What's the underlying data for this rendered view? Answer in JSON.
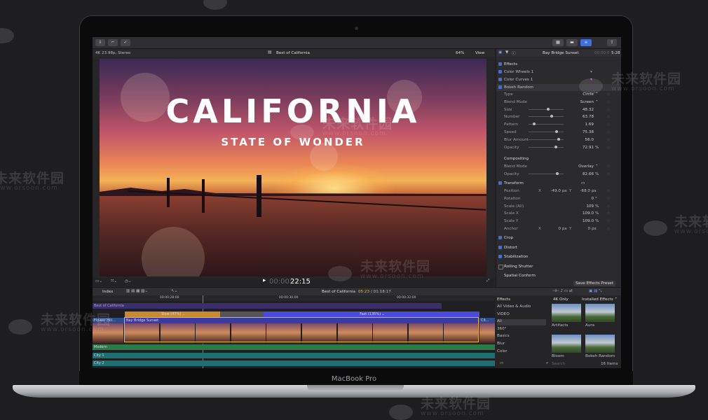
{
  "watermark": {
    "text": "未来软件园",
    "url": "www.orsoon.com"
  },
  "laptop": {
    "brand_label": "MacBook Pro"
  },
  "toolbar": {
    "icons": [
      "import-icon",
      "keyword-icon",
      "check-icon",
      "library-icon",
      "timeline-icon",
      "inspector-icon",
      "share-icon"
    ]
  },
  "viewer": {
    "format": "4K 23.98p, Stereo",
    "project": "Best of California",
    "zoom": "64%",
    "view_label": "View",
    "title_line1": "CALIFORNIA",
    "title_line2": "STATE OF WONDER",
    "timecode_dim": "00:00:",
    "timecode": "22:15"
  },
  "inspector": {
    "clip_name": "Bay Bridge Sunset",
    "clip_time_dim": "00:00:0",
    "clip_time": "5:28",
    "effects_header": "Effects",
    "effects": [
      "Color Wheels 1",
      "Color Curves 1",
      "Bokeh Random"
    ],
    "bokeh_params": [
      {
        "label": "Type",
        "value": "Circle",
        "unit": "⌃"
      },
      {
        "label": "Blend Mode",
        "value": "Screen",
        "unit": "⌃"
      },
      {
        "label": "Size",
        "value": "48.32",
        "unit": "",
        "level": 0.55
      },
      {
        "label": "Number",
        "value": "63.78",
        "unit": "",
        "level": 0.65
      },
      {
        "label": "Pattern",
        "value": "1.69",
        "unit": "",
        "level": 0.12
      },
      {
        "label": "Speed",
        "value": "75.38",
        "unit": "",
        "level": 0.8
      },
      {
        "label": "Blur Amount",
        "value": "56.0",
        "unit": "",
        "level": 0.85
      },
      {
        "label": "Opacity",
        "value": "72.91",
        "unit": "%",
        "level": 0.78
      }
    ],
    "compositing_header": "Compositing",
    "compositing": [
      {
        "label": "Blend Mode",
        "value": "Overlay",
        "unit": "⌃"
      },
      {
        "label": "Opacity",
        "value": "82.66",
        "unit": "%",
        "level": 0.82
      }
    ],
    "transform_header": "Transform",
    "transform": [
      {
        "label": "Position",
        "x": "-49.0",
        "y": "-68.0",
        "unit": "px"
      },
      {
        "label": "Rotation",
        "value": "0",
        "unit": "°"
      },
      {
        "label": "Scale (All)",
        "value": "109",
        "unit": "%"
      },
      {
        "label": "Scale X",
        "value": "109.0",
        "unit": "%"
      },
      {
        "label": "Scale Y",
        "value": "109.0",
        "unit": "%"
      },
      {
        "label": "Anchor",
        "x": "0",
        "y": "0",
        "unit": "px"
      }
    ],
    "sections": [
      "Crop",
      "Distort",
      "Stabilization",
      "Rolling Shutter",
      "Spatial Conform"
    ],
    "save_preset": "Save Effects Preset"
  },
  "timeline": {
    "index_label": "Index",
    "project": "Best of California",
    "position": "05:23",
    "duration": "/ 01:18:17",
    "ruler": [
      "00:00:28:00",
      "00:00:30:00",
      "00:00:32:00"
    ],
    "top_track": "Best of California",
    "speed_slow": "Slow (47%) ⌄",
    "speed_fast": "Fast (135%) ⌄",
    "clip_left": "Flower Hill...",
    "clip_main": "Bay Bridge Sunset",
    "clip_right": "Cit...",
    "audio_tracks": [
      "Modern",
      "City 1",
      "City 2"
    ]
  },
  "browser": {
    "effects_label": "Effects",
    "filter_4k": "4K Only",
    "installed": "Installed Effects ⌃",
    "categories": [
      "All Video & Audio",
      "VIDEO",
      "All",
      "360°",
      "Basics",
      "Blur",
      "Color"
    ],
    "thumbs": [
      "Artifacts",
      "Aura",
      "Bloom",
      "Bokeh Random"
    ],
    "search_placeholder": "Search",
    "count": "16 Items"
  },
  "colors": {
    "accent": "#3d6fe0",
    "clip_selected": "#e6b84a",
    "speed_slow": "#c98a2e",
    "speed_fast": "#4a4adf",
    "audio_green": "#2a7a4a",
    "audio_teal": "#1f6f72"
  }
}
